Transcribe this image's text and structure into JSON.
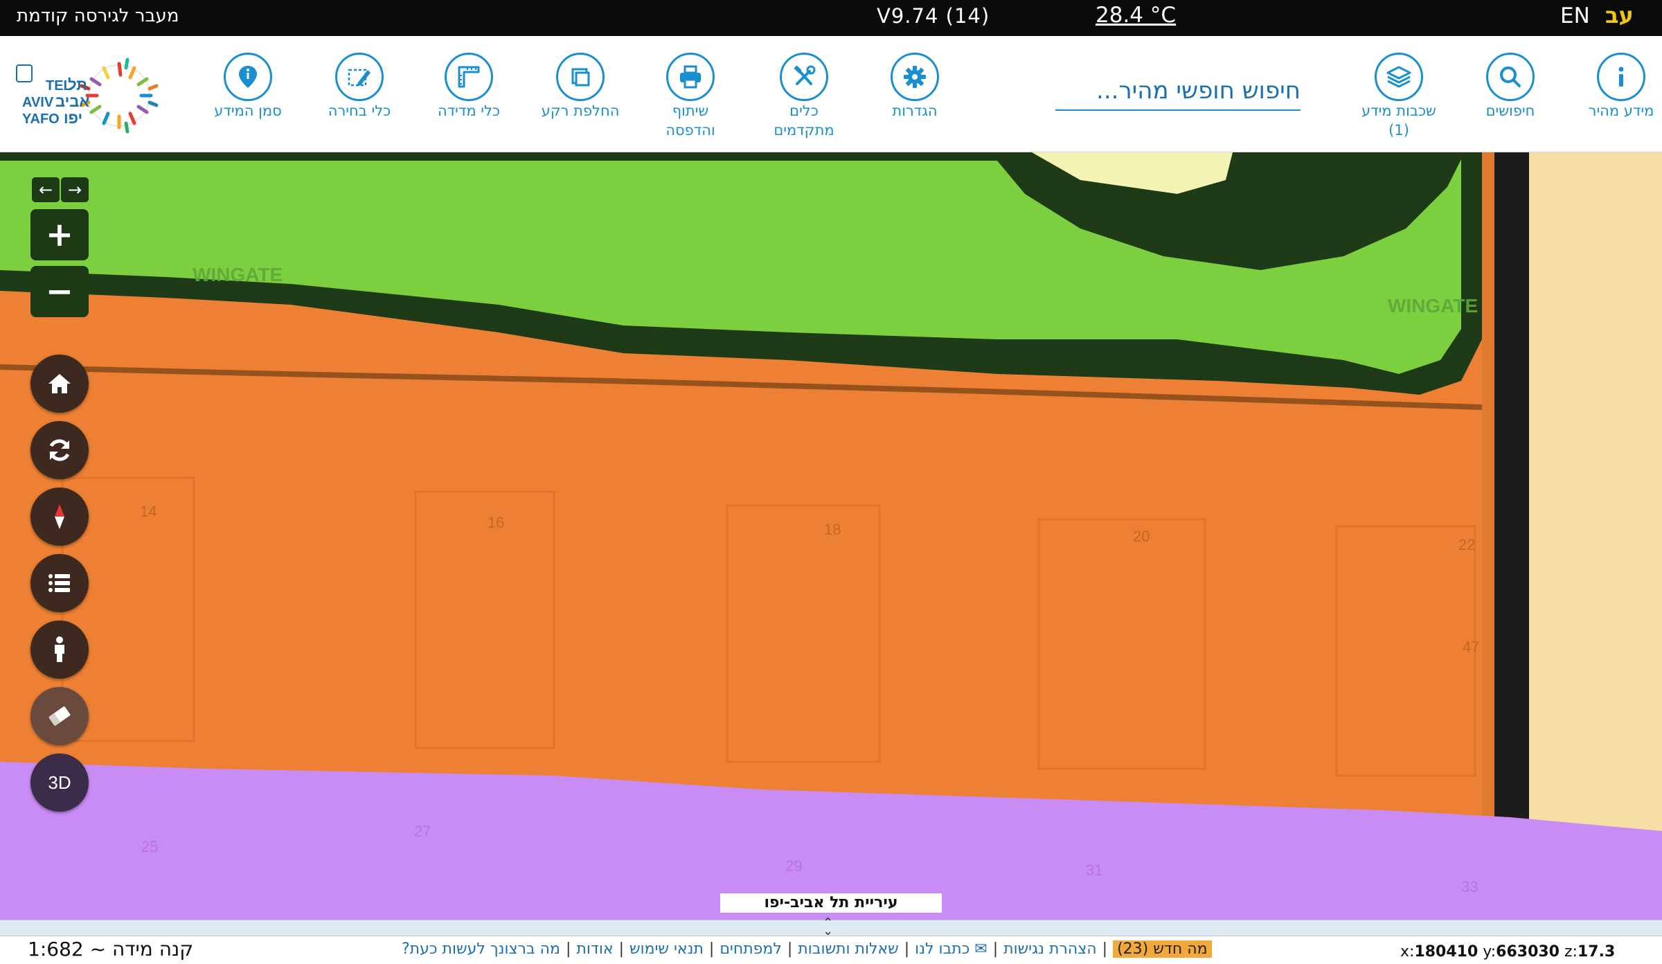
{
  "topbar": {
    "prev_version_label": "מעבר לגירסה קודמת",
    "version": "V9.74 (14)",
    "temperature": "28.4 °C",
    "lang_en": "EN",
    "lang_he": "עב"
  },
  "toolbar": {
    "items": [
      {
        "label": "מידע מהיר",
        "icon": "info-icon"
      },
      {
        "label": "חיפושים",
        "icon": "search-icon"
      },
      {
        "label": "שכבות מידע\n(1)",
        "icon": "layers-icon"
      },
      {
        "label": "הגדרות",
        "icon": "gear-icon"
      },
      {
        "label": "כלים\nמתקדמים",
        "icon": "tools-icon"
      },
      {
        "label": "שיתוף\nוהדפסה",
        "icon": "print-icon"
      },
      {
        "label": "החלפת רקע",
        "icon": "basemap-icon"
      },
      {
        "label": "כלי מדידה",
        "icon": "ruler-icon"
      },
      {
        "label": "כלי בחירה",
        "icon": "select-icon"
      },
      {
        "label": "סמן המידע",
        "icon": "marker-icon"
      }
    ],
    "search_placeholder": "חיפוש חופשי מהיר..."
  },
  "logo": {
    "text_he_1": "תל",
    "text_he_2": "אביב",
    "text_he_3": "יפו",
    "text_en_1": "TEL",
    "text_en_2": "AVIV",
    "text_en_3": "YAFO"
  },
  "map": {
    "street_labels": [
      "WINGATE",
      "WINGATE"
    ],
    "parcel_numbers": [
      "14",
      "16",
      "18",
      "20",
      "22",
      "47",
      "25",
      "27",
      "29",
      "31",
      "33"
    ],
    "colors": {
      "green": "#7ccf3f",
      "dark_green": "#1f3a17",
      "orange": "#ed8034",
      "purple": "#c98cf5",
      "sand": "#f6dfa6",
      "road": "#1c1c1c"
    },
    "city_label": "עיריית תל אביב-יפו"
  },
  "controls": {
    "zoom_in": "+",
    "zoom_out": "−",
    "history_back": "←",
    "history_forward": "→",
    "three_d": "3D"
  },
  "footer": {
    "scale_label": "קנה מידה ~ 1:682",
    "links": [
      "מה ברצונך לעשות כעת?",
      "אודות",
      "תנאי שימוש",
      "למפתחים",
      "שאלות ותשובות",
      "✉ כתבו לנו",
      "הצהרת נגישות"
    ],
    "whats_new": "מה חדש (23)",
    "coord_x_label": "x:",
    "coord_x": "180410",
    "coord_y_label": "y:",
    "coord_y": "663030",
    "coord_z_label": "z:",
    "coord_z": "17.3"
  }
}
